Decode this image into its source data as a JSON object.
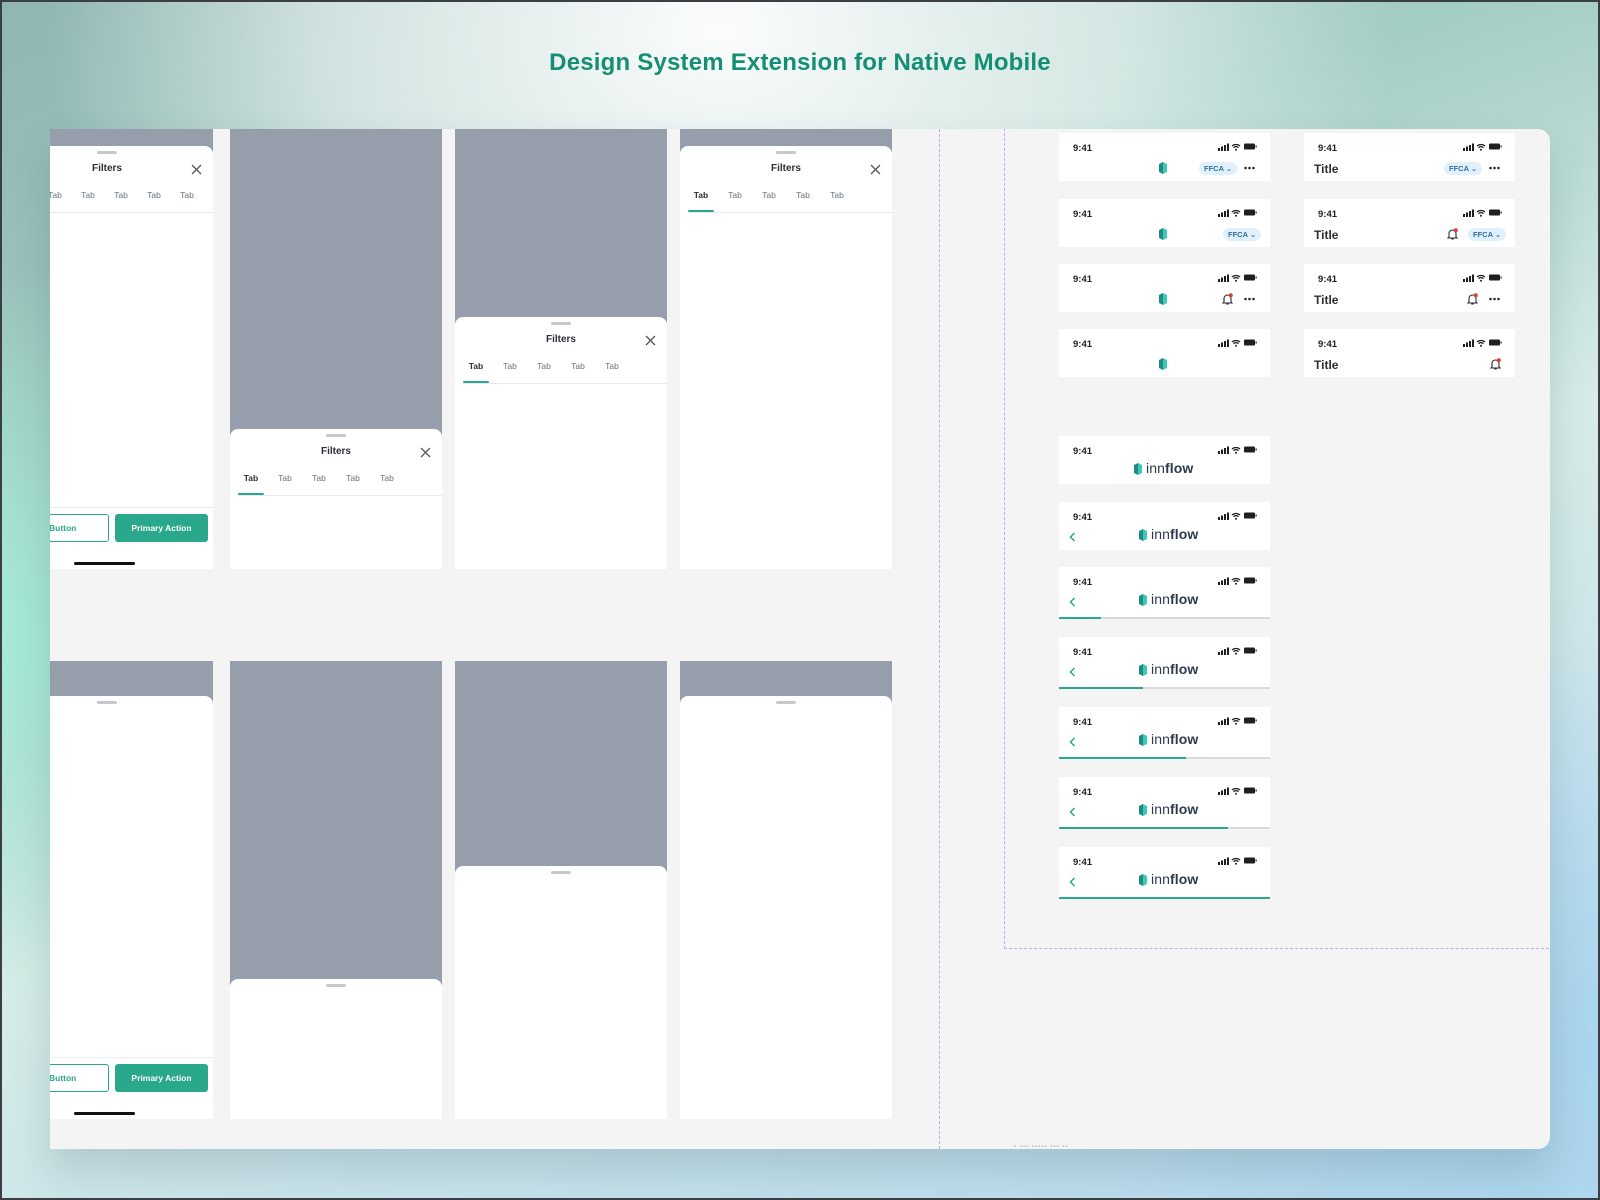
{
  "page": {
    "title": "Design System Extension for Native Mobile"
  },
  "sheet": {
    "title": "Filters",
    "tab_label": "Tab",
    "secondary_label": "Button",
    "primary_label": "Primary Action"
  },
  "status": {
    "time": "9:41"
  },
  "navbars": {
    "title": "Title",
    "chip": "FFCA",
    "logo_inn": "inn",
    "logo_flow": "flow",
    "progress": [
      0.2,
      0.4,
      0.6,
      0.8,
      1.0
    ]
  },
  "colors": {
    "accent": "#2aa88c",
    "title": "#148f74",
    "scrim": "#959eaa",
    "chip_bg": "#e2f0fb",
    "notification_dot": "#e53935"
  },
  "icons": [
    "close-icon",
    "innflow-mark-icon",
    "bell-icon",
    "more-icon",
    "back-chevron-icon",
    "signal-icon",
    "wifi-icon",
    "battery-icon",
    "chevron-down-icon"
  ]
}
